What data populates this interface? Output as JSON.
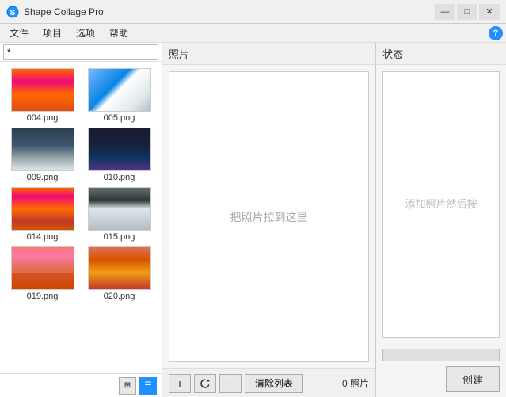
{
  "window": {
    "title": "Shape Collage Pro",
    "min_btn": "—",
    "max_btn": "□",
    "close_btn": "✕"
  },
  "menu": {
    "items": [
      "文件",
      "项目",
      "选项",
      "帮助"
    ]
  },
  "left_panel": {
    "path_value": "*",
    "photos": [
      {
        "id": "004",
        "label": "004.png",
        "thumb_class": "thumb-004"
      },
      {
        "id": "005",
        "label": "005.png",
        "thumb_class": "thumb-005"
      },
      {
        "id": "009",
        "label": "009.png",
        "thumb_class": "thumb-009"
      },
      {
        "id": "010",
        "label": "010.png",
        "thumb_class": "thumb-010"
      },
      {
        "id": "014",
        "label": "014.png",
        "thumb_class": "thumb-014"
      },
      {
        "id": "015",
        "label": "015.png",
        "thumb_class": "thumb-015"
      },
      {
        "id": "019",
        "label": "019.png",
        "thumb_class": "thumb-019"
      },
      {
        "id": "020",
        "label": "020.png",
        "thumb_class": "thumb-020"
      }
    ]
  },
  "photos_panel": {
    "header": "照片",
    "drop_text": "把照片拉到这里",
    "add_btn": "+",
    "refresh_btn": "↻",
    "remove_btn": "−",
    "clear_btn": "清除列表",
    "count_text": "0 照片"
  },
  "status_panel": {
    "header": "状态",
    "preview_text": "添加照片然后按",
    "create_btn": "创建"
  }
}
